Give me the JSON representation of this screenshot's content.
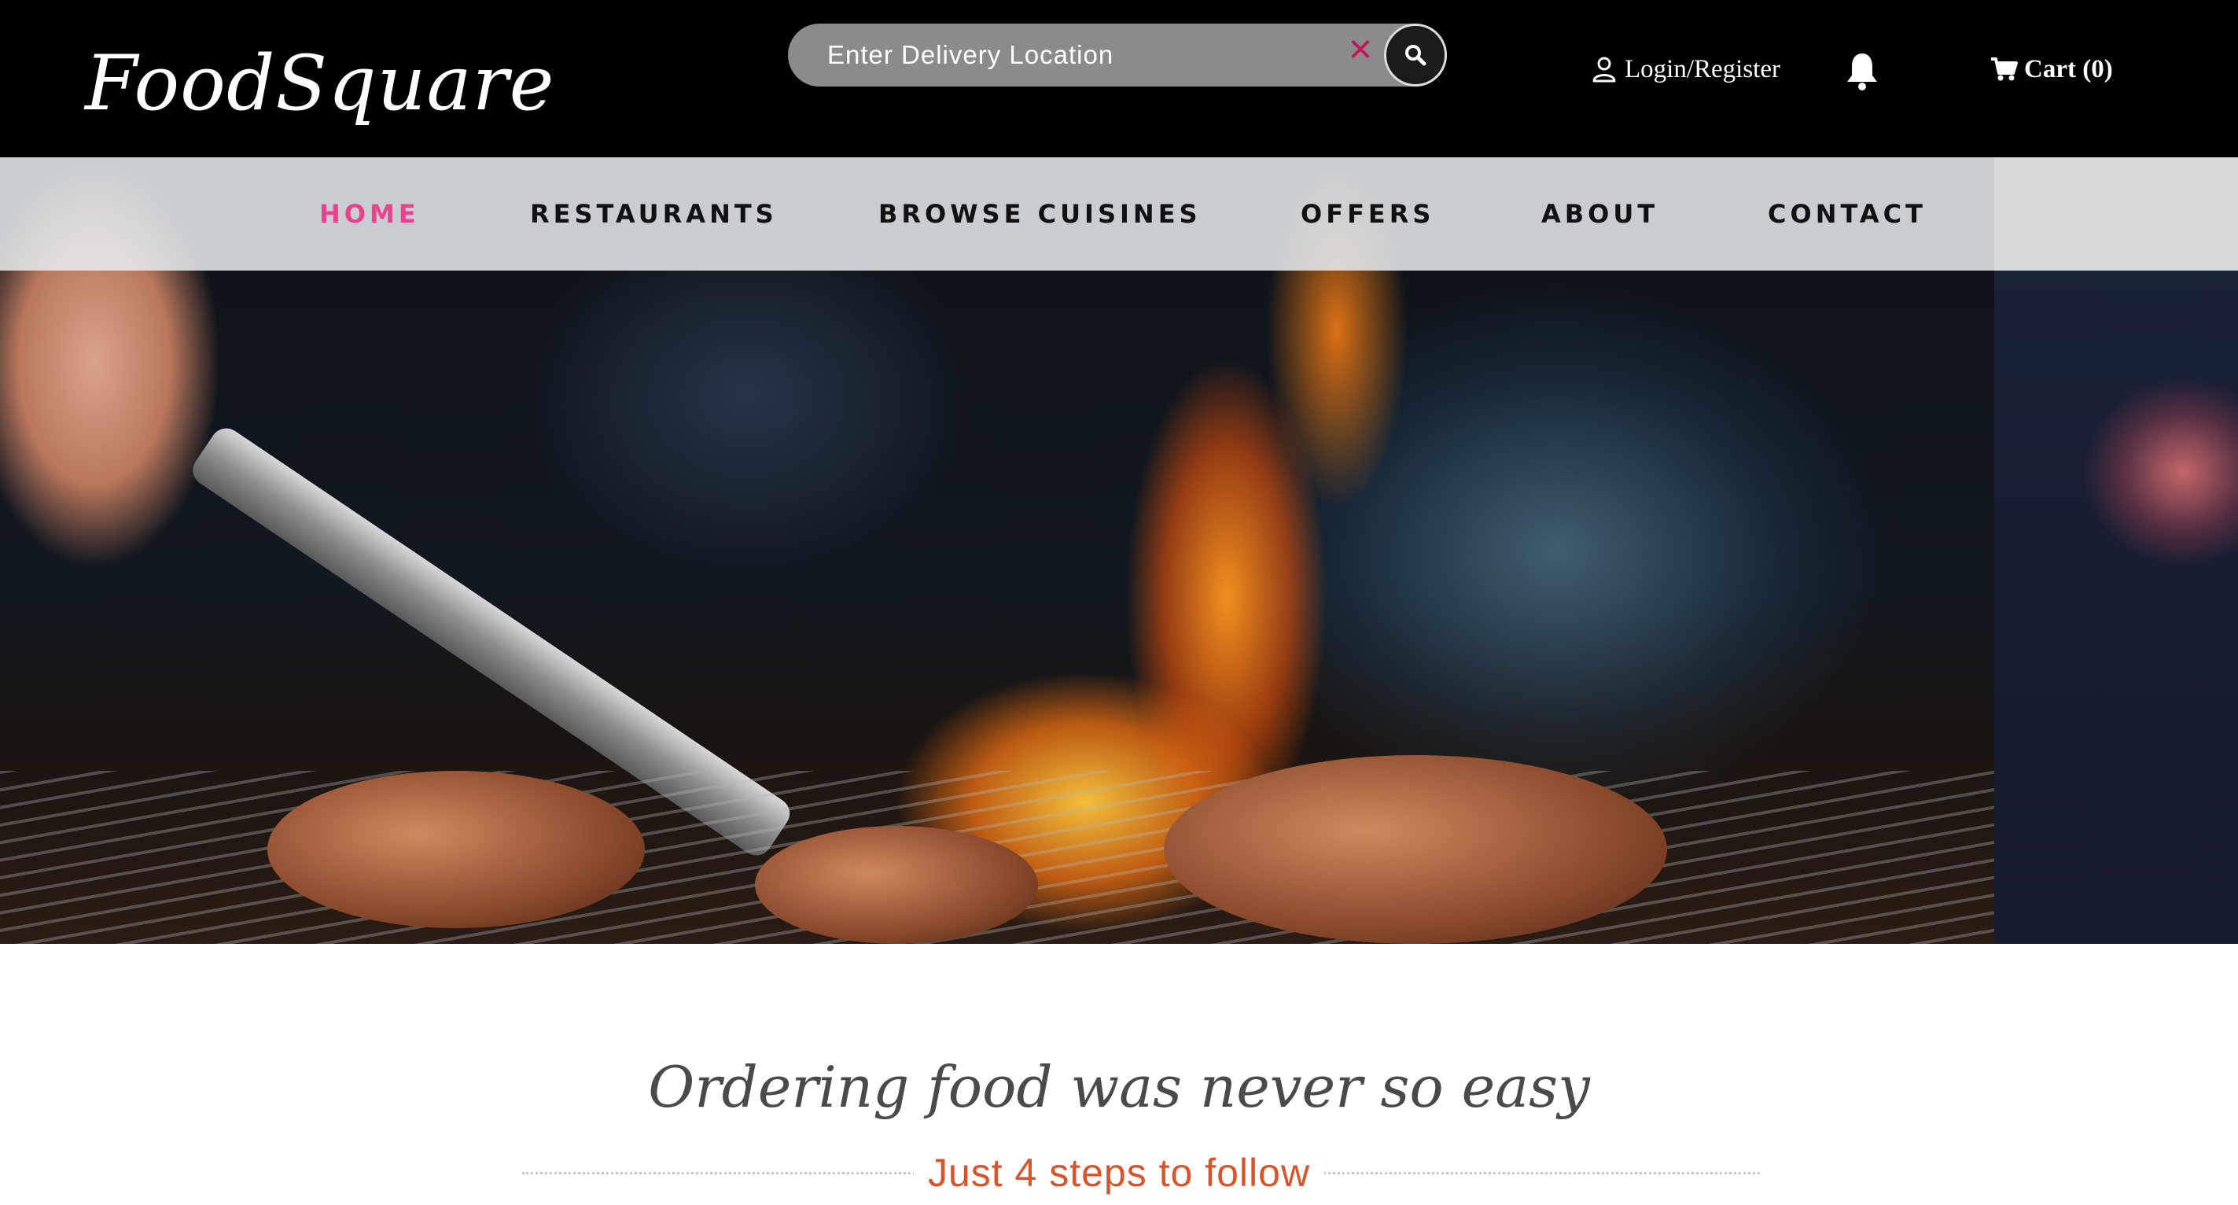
{
  "header": {
    "logo": "FoodSquare",
    "search": {
      "placeholder": "Enter Delivery Location",
      "clear_icon": "close-icon",
      "button_icon": "search-icon"
    },
    "login_label": "Login/Register",
    "login_icon": "user-icon",
    "notification_icon": "bell-icon",
    "cart_label": "Cart (0)",
    "cart_icon": "cart-icon"
  },
  "nav": {
    "items": [
      {
        "label": "HOME",
        "active": true
      },
      {
        "label": "RESTAURANTS",
        "active": false
      },
      {
        "label": "BROWSE CUISINES",
        "active": false
      },
      {
        "label": "OFFERS",
        "active": false
      },
      {
        "label": "ABOUT",
        "active": false
      },
      {
        "label": "CONTACT",
        "active": false
      }
    ],
    "active_color": "#e8438d"
  },
  "main": {
    "heading": "Ordering food was never so easy",
    "subheading": "Just 4 steps to follow"
  },
  "colors": {
    "header_bg": "#000000",
    "accent_pink": "#e8438d",
    "subheading": "#d9532b",
    "clear_icon": "#c2185b"
  }
}
